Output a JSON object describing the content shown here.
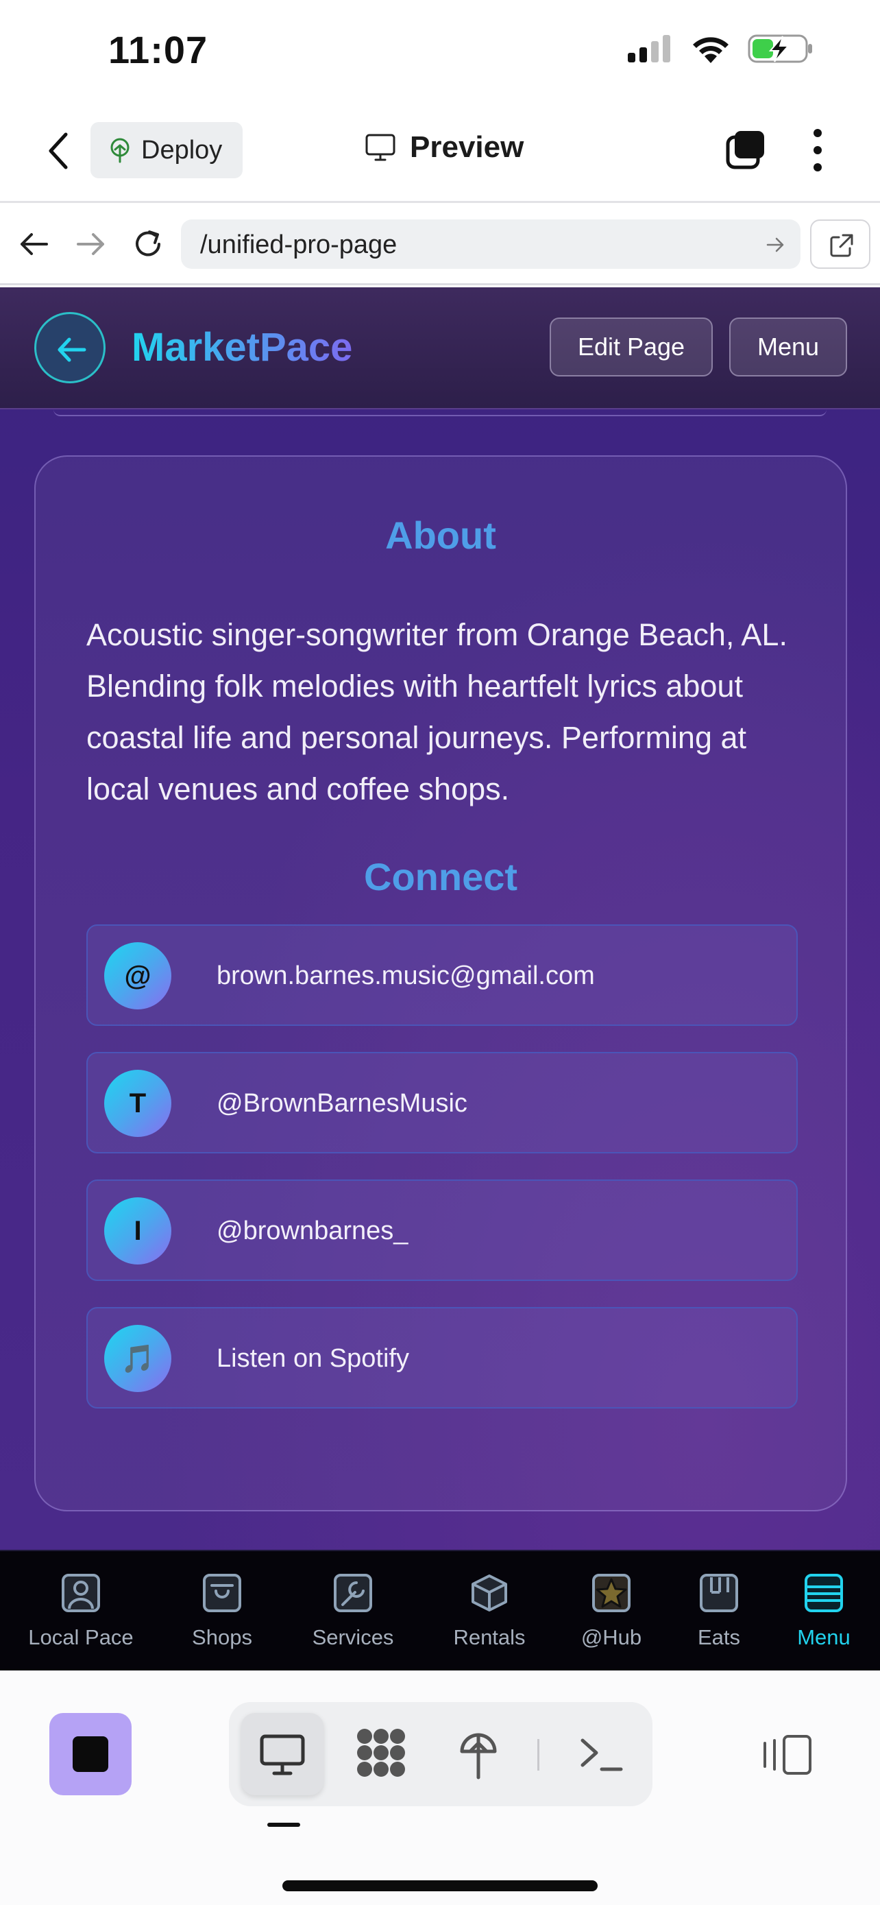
{
  "status_bar": {
    "time": "11:07"
  },
  "top_bar": {
    "deploy_label": "Deploy",
    "preview_label": "Preview"
  },
  "url_bar": {
    "url": "/unified-pro-page"
  },
  "app": {
    "brand": "MarketPace",
    "edit_page_label": "Edit Page",
    "menu_label": "Menu",
    "about": {
      "title": "About",
      "text": "Acoustic singer-songwriter from Orange Beach, AL. Blending folk melodies with heartfelt lyrics about coastal life and personal journeys. Performing at local venues and coffee shops."
    },
    "connect": {
      "title": "Connect",
      "links": [
        {
          "avatar": "@",
          "text": "brown.barnes.music@gmail.com"
        },
        {
          "avatar": "T",
          "text": "@BrownBarnesMusic"
        },
        {
          "avatar": "I",
          "text": "@brownbarnes_"
        },
        {
          "avatar": "🎵",
          "text": "Listen on Spotify"
        }
      ]
    },
    "nav": [
      {
        "label": "Local Pace",
        "icon": "person-icon"
      },
      {
        "label": "Shops",
        "icon": "shopping-bag-icon"
      },
      {
        "label": "Services",
        "icon": "wrench-icon"
      },
      {
        "label": "Rentals",
        "icon": "box-icon"
      },
      {
        "label": "@Hub",
        "icon": "star-icon"
      },
      {
        "label": "Eats",
        "icon": "restaurant-icon"
      },
      {
        "label": "Menu",
        "icon": "menu-icon",
        "active": true
      }
    ]
  },
  "colors": {
    "accent": "#22d3ee",
    "heading": "#4f9ee8",
    "stop": "#b5a2f5"
  }
}
